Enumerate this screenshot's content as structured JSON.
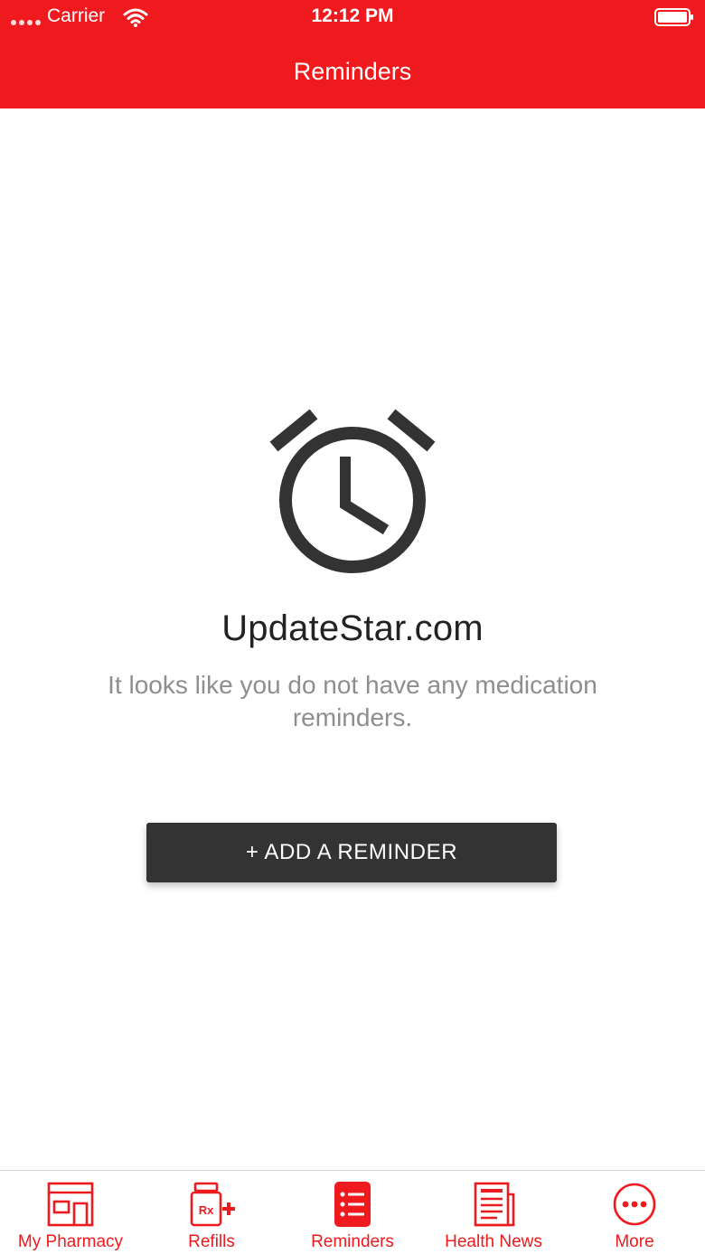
{
  "status_bar": {
    "carrier": "Carrier",
    "time": "12:12 PM"
  },
  "nav": {
    "title": "Reminders"
  },
  "empty_state": {
    "title": "UpdateStar.com",
    "message": "It looks like you do not have any medication reminders.",
    "icon": "alarm-clock-icon"
  },
  "add_button": {
    "label": "+ ADD A REMINDER"
  },
  "tabs": [
    {
      "label": "My Pharmacy",
      "icon": "pharmacy-store-icon"
    },
    {
      "label": "Refills",
      "icon": "rx-refill-icon"
    },
    {
      "label": "Reminders",
      "icon": "reminders-list-icon",
      "selected": true
    },
    {
      "label": "Health News",
      "icon": "newspaper-icon"
    },
    {
      "label": "More",
      "icon": "more-dots-icon"
    }
  ],
  "colors": {
    "accent": "#ee1a1e",
    "button": "#333333",
    "icon": "#333333",
    "muted_text": "#8e8e8e"
  }
}
